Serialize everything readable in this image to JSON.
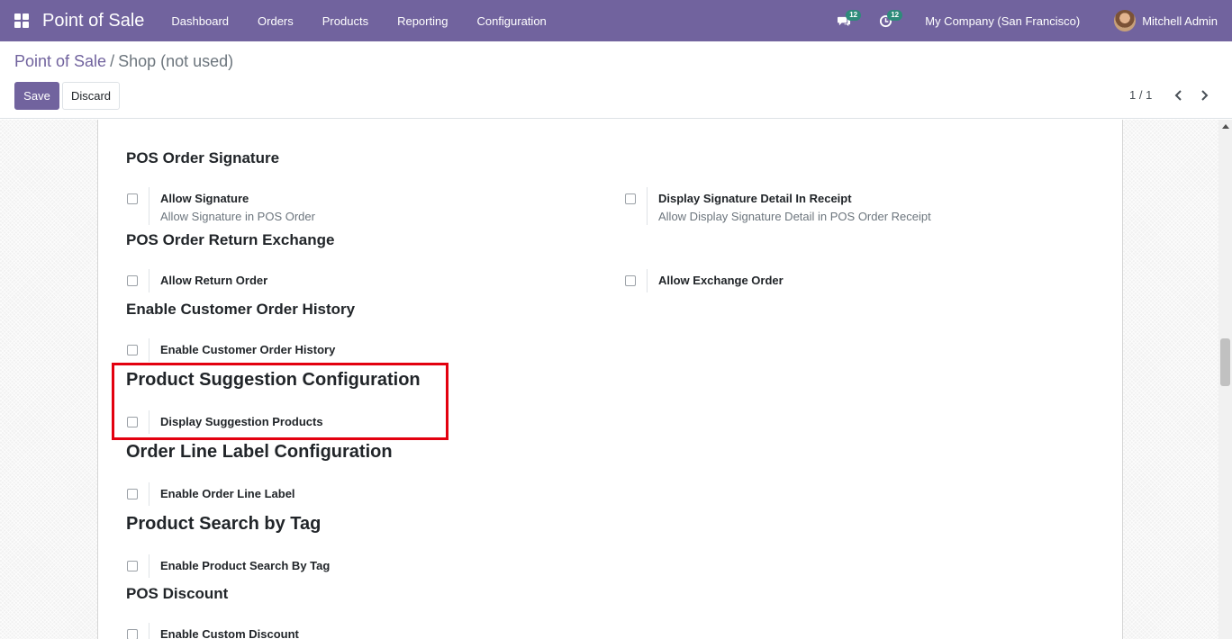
{
  "navbar": {
    "brand": "Point of Sale",
    "menu": [
      "Dashboard",
      "Orders",
      "Products",
      "Reporting",
      "Configuration"
    ],
    "messages_count": "12",
    "activities_count": "12",
    "company": "My Company (San Francisco)",
    "user": "Mitchell Admin"
  },
  "breadcrumb": {
    "parent": "Point of Sale",
    "separator": "/",
    "current": "Shop (not used)"
  },
  "actions": {
    "save": "Save",
    "discard": "Discard"
  },
  "pager": {
    "value": "1 / 1"
  },
  "sections": {
    "signature": {
      "title": "POS Order Signature",
      "allow_signature": {
        "label": "Allow Signature",
        "desc": "Allow Signature in POS Order",
        "checked": false
      },
      "display_signature": {
        "label": "Display Signature Detail In Receipt",
        "desc": "Allow Display Signature Detail in POS Order Receipt",
        "checked": false
      }
    },
    "return_exchange": {
      "title": "POS Order Return Exchange",
      "allow_return": {
        "label": "Allow Return Order",
        "checked": false
      },
      "allow_exchange": {
        "label": "Allow Exchange Order",
        "checked": false
      }
    },
    "customer_history": {
      "title": "Enable Customer Order History",
      "enable": {
        "label": "Enable Customer Order History",
        "checked": false
      }
    },
    "product_suggestion": {
      "title": "Product Suggestion Configuration",
      "display": {
        "label": "Display Suggestion Products",
        "checked": false
      }
    },
    "order_line_label": {
      "title": "Order Line Label Configuration",
      "enable": {
        "label": "Enable Order Line Label",
        "checked": false
      }
    },
    "search_by_tag": {
      "title": "Product Search by Tag",
      "enable": {
        "label": "Enable Product Search By Tag",
        "checked": false
      }
    },
    "discount": {
      "title": "POS Discount",
      "enable": {
        "label": "Enable Custom Discount",
        "checked": false
      }
    }
  },
  "colors": {
    "brand": "#71639e",
    "badge": "#2e8b7a",
    "highlight": "#e3000f"
  }
}
